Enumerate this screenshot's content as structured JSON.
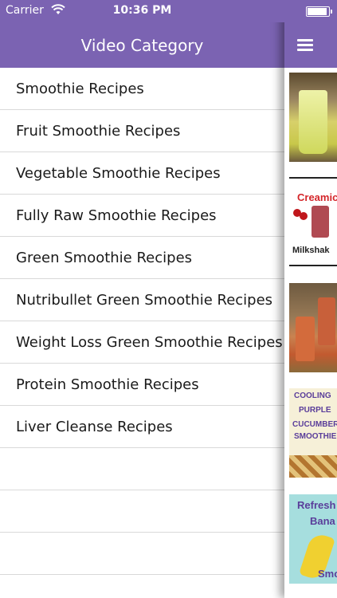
{
  "status_bar": {
    "carrier": "Carrier",
    "time": "10:36 PM"
  },
  "drawer": {
    "title": "Video Category",
    "items": [
      {
        "label": "Smoothie Recipes"
      },
      {
        "label": "Fruit Smoothie Recipes"
      },
      {
        "label": "Vegetable Smoothie Recipes"
      },
      {
        "label": "Fully Raw Smoothie Recipes"
      },
      {
        "label": "Green Smoothie Recipes"
      },
      {
        "label": "Nutribullet Green Smoothie Recipes"
      },
      {
        "label": "Weight Loss Green Smoothie Recipes"
      },
      {
        "label": "Protein Smoothie Recipes"
      },
      {
        "label": "Liver Cleanse Recipes"
      }
    ]
  },
  "content": {
    "menu_icon": "hamburger-icon",
    "thumbnails": [
      {
        "name": "green-smoothie-thumbnail"
      },
      {
        "name": "creamicle-milkshake-thumbnail",
        "title": "Creamic",
        "subtitle": "Milkshak"
      },
      {
        "name": "orange-smoothie-jars-thumbnail"
      },
      {
        "name": "cooling-purple-cucumber-smoothie-thumbnail",
        "lines": [
          "COOLING",
          "PURPLE",
          "CUCUMBER",
          "SMOOTHIE"
        ]
      },
      {
        "name": "refreshing-banana-smoothie-thumbnail",
        "lines": [
          "Refresh",
          "Bana",
          "Smo"
        ]
      }
    ]
  },
  "colors": {
    "accent": "#7b63b2",
    "divider": "#d9d9d9",
    "text": "#1a1a1a"
  }
}
